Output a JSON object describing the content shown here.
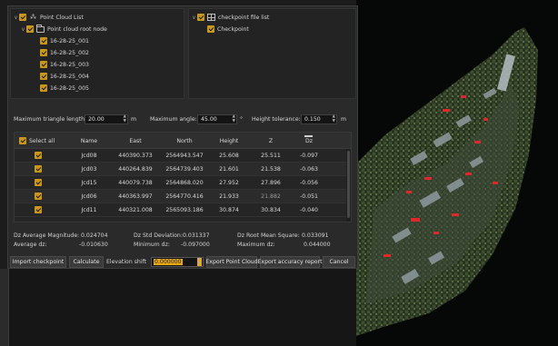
{
  "point_cloud_panel": {
    "list_title": "Point Cloud List",
    "root_node": "Point cloud root node",
    "items": [
      "16-28-25_001",
      "16-28-25_002",
      "16-28-25_003",
      "16-28-25_004",
      "16-28-25_005"
    ]
  },
  "checkpoint_panel": {
    "list_title": "checkpoint file list",
    "item": "Checkpoint"
  },
  "params": {
    "max_triangle_length_label": "Maximum triangle length:",
    "max_triangle_length_value": "20.00",
    "max_triangle_length_unit": "m",
    "max_angle_label": "Maximum angle:",
    "max_angle_value": "45.00",
    "max_angle_unit": "°",
    "height_tolerance_label": "Height tolerance:",
    "height_tolerance_value": "0.150",
    "height_tolerance_unit": "m"
  },
  "table": {
    "select_all": "Select all",
    "headers": [
      "Name",
      "East",
      "North",
      "Height",
      "Z",
      "Dz"
    ],
    "rows": [
      {
        "name": "Jcd08",
        "east": "440390.373",
        "north": "2564943.547",
        "height": "25.608",
        "z": "25.511",
        "dz": "-0.097"
      },
      {
        "name": "Jcd03",
        "east": "440264.839",
        "north": "2564739.403",
        "height": "21.601",
        "z": "21.538",
        "dz": "-0.063"
      },
      {
        "name": "Jcd15",
        "east": "440079.738",
        "north": "2564868.020",
        "height": "27.952",
        "z": "27.896",
        "dz": "-0.056"
      },
      {
        "name": "Jcd06",
        "east": "440363.997",
        "north": "2564770.416",
        "height": "21.933",
        "z": "21.882",
        "dz": "-0.051"
      },
      {
        "name": "Jcd11",
        "east": "440321.008",
        "north": "2565093.186",
        "height": "30.874",
        "z": "30.834",
        "dz": "-0.040"
      }
    ]
  },
  "stats": {
    "avg_magnitude_label": "Dz Average Magnitude:",
    "avg_magnitude_value": "0.024704",
    "std_dev_label": "Dz Std Deviation:",
    "std_dev_value": "0.031337",
    "rms_label": "Dz Root Mean Square:",
    "rms_value": "0.033091",
    "avg_dz_label": "Average dz:",
    "avg_dz_value": "-0.010630",
    "min_dz_label": "Minimum dz:",
    "min_dz_value": "-0.097000",
    "max_dz_label": "Maximum dz:",
    "max_dz_value": "0.044000"
  },
  "buttons": {
    "import_checkpoint": "Import checkpoint",
    "calculate": "Calculate",
    "elevation_shift_label": "Elevation shift",
    "elevation_shift_value": "0.000000",
    "export_point_cloud": "Export Point Cloud",
    "export_accuracy_report": "Export accuracy report",
    "cancel": "Cancel"
  },
  "colors": {
    "accent": "#c9961b",
    "highlight": "#e8a90f",
    "checkpoint_marker": "#e0282a"
  }
}
